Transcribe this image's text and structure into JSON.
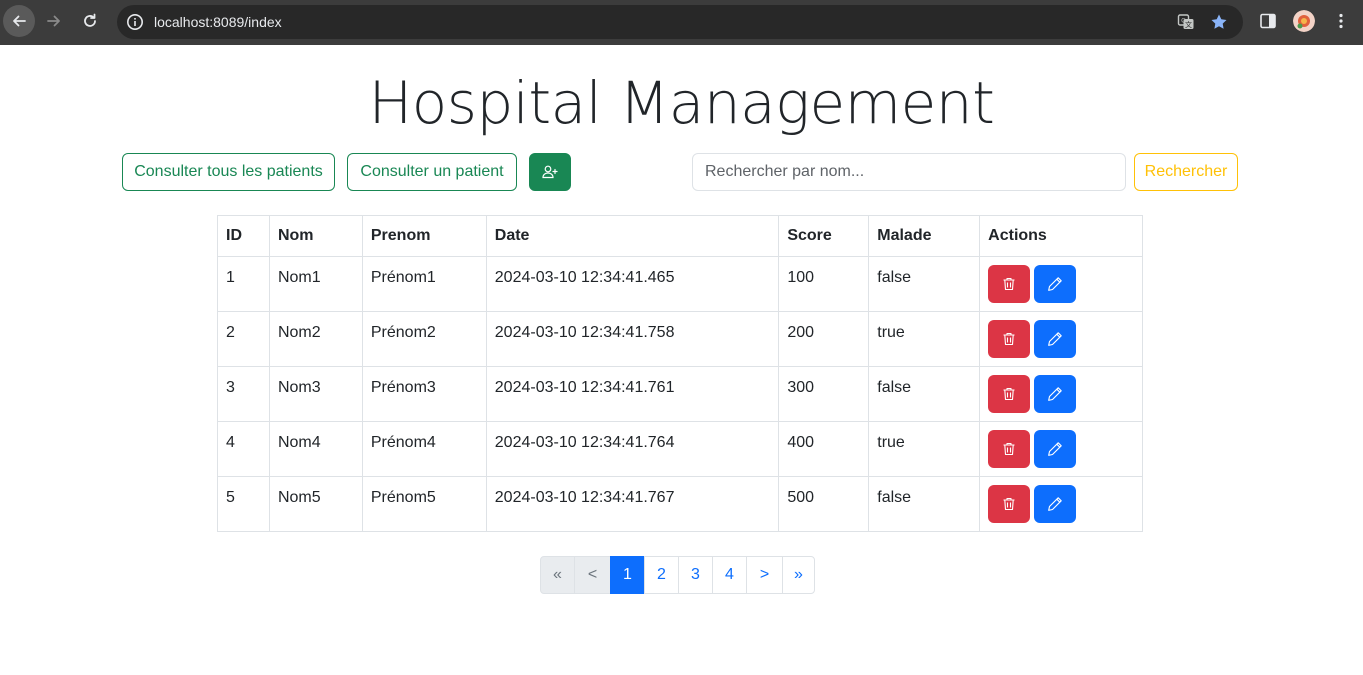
{
  "browser": {
    "url": "localhost:8089/index"
  },
  "page": {
    "title": "Hospital Management"
  },
  "toolbar": {
    "all_patients_label": "Consulter tous les patients",
    "one_patient_label": "Consulter un patient",
    "add_icon": "user-plus-icon",
    "search_placeholder": "Rechercher par nom...",
    "search_value": "",
    "search_label": "Rechercher"
  },
  "table": {
    "headers": [
      "ID",
      "Nom",
      "Prenom",
      "Date",
      "Score",
      "Malade",
      "Actions"
    ],
    "rows": [
      {
        "id": "1",
        "nom": "Nom1",
        "prenom": "Prénom1",
        "date": "2024-03-10 12:34:41.465",
        "score": "100",
        "malade": "false"
      },
      {
        "id": "2",
        "nom": "Nom2",
        "prenom": "Prénom2",
        "date": "2024-03-10 12:34:41.758",
        "score": "200",
        "malade": "true"
      },
      {
        "id": "3",
        "nom": "Nom3",
        "prenom": "Prénom3",
        "date": "2024-03-10 12:34:41.761",
        "score": "300",
        "malade": "false"
      },
      {
        "id": "4",
        "nom": "Nom4",
        "prenom": "Prénom4",
        "date": "2024-03-10 12:34:41.764",
        "score": "400",
        "malade": "true"
      },
      {
        "id": "5",
        "nom": "Nom5",
        "prenom": "Prénom5",
        "date": "2024-03-10 12:34:41.767",
        "score": "500",
        "malade": "false"
      }
    ]
  },
  "pagination": {
    "first": "«",
    "prev": "<",
    "pages": [
      "1",
      "2",
      "3",
      "4"
    ],
    "active_page": "1",
    "next": ">",
    "last": "»"
  },
  "colors": {
    "success": "#198754",
    "warning": "#ffc107",
    "danger": "#dc3545",
    "primary": "#0d6efd"
  }
}
